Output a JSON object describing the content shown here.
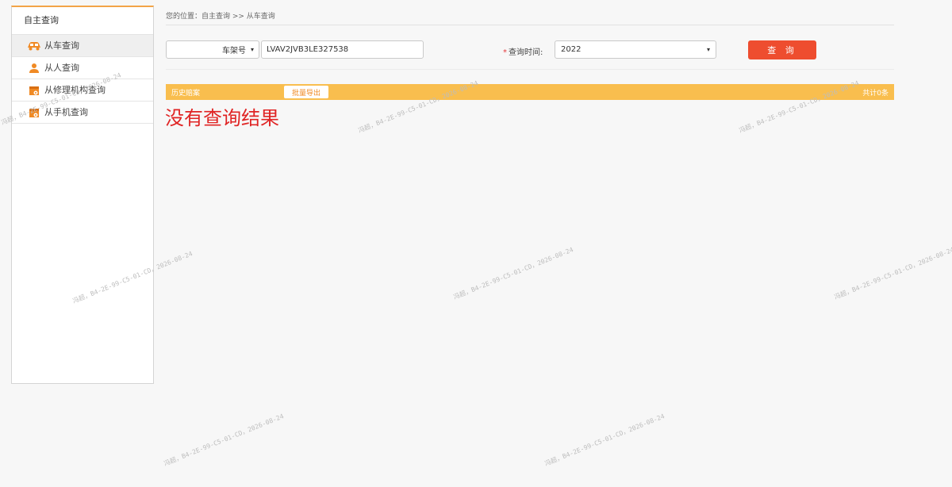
{
  "sidebar": {
    "header": "自主查询",
    "items": [
      {
        "label": "从车查询",
        "icon": "car-icon",
        "active": true
      },
      {
        "label": "从人查询",
        "icon": "person-icon",
        "active": false
      },
      {
        "label": "从修理机构查询",
        "icon": "repair-shop-icon",
        "active": false
      },
      {
        "label": "从手机查询",
        "icon": "phone-icon",
        "active": false
      }
    ]
  },
  "breadcrumb": "您的位置：自主查询 >> 从车查询",
  "search": {
    "field_select": "车架号",
    "vin_value": "LVAV2JVB3LE327538",
    "required_mark": "*",
    "time_label": "查询时间:",
    "year_value": "2022",
    "query_button": "查 询"
  },
  "results": {
    "bar_title": "历史赔案",
    "export_button": "批量导出",
    "total": "共计0条",
    "empty_message": "没有查询结果"
  },
  "watermark": "冯超，B4-2E-99-C5-01-CD，2026-08-24",
  "colors": {
    "accent_orange": "#f9be4e",
    "query_button": "#ee4d2f",
    "empty_text": "#e02424",
    "sidebar_icon": "#f08a24"
  }
}
